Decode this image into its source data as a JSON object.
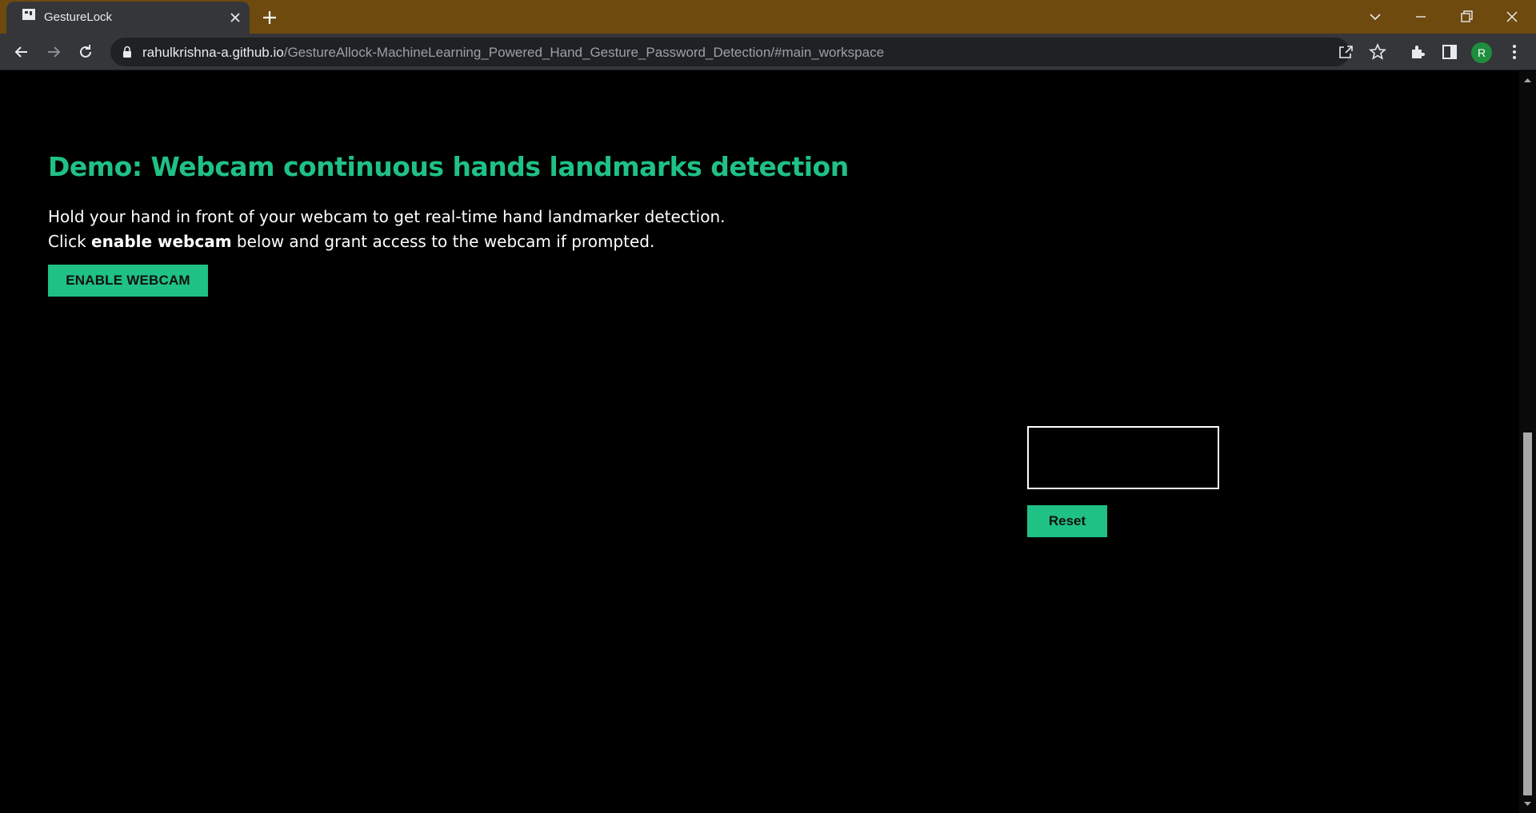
{
  "browser": {
    "tab_title": "GestureLock",
    "url_host": "rahulkrishna-a.github.io",
    "url_path": "/GestureAllock-MachineLearning_Powered_Hand_Gesture_Password_Detection/#main_workspace",
    "profile_initial": "R"
  },
  "main": {
    "heading": "Demo: Webcam continuous hands landmarks detection",
    "desc_line1": "Hold your hand in front of your webcam to get real-time hand landmarker detection.",
    "desc_line2_prefix": "Click ",
    "desc_line2_bold": "enable webcam",
    "desc_line2_suffix": " below and grant access to the webcam if prompted.",
    "enable_button": "ENABLE WEBCAM",
    "output_value": "",
    "reset_button": "Reset"
  },
  "colors": {
    "accent": "#1fc184",
    "titlebar": "#6e4a0f",
    "background": "#000000"
  },
  "icons": [
    "favicon-icon",
    "close-icon",
    "plus-icon",
    "chevron-down-icon",
    "minimize-icon",
    "restore-icon",
    "close-window-icon",
    "back-icon",
    "forward-icon",
    "reload-icon",
    "lock-icon",
    "share-icon",
    "star-icon",
    "extensions-icon",
    "sidepanel-icon",
    "menu-icon"
  ]
}
